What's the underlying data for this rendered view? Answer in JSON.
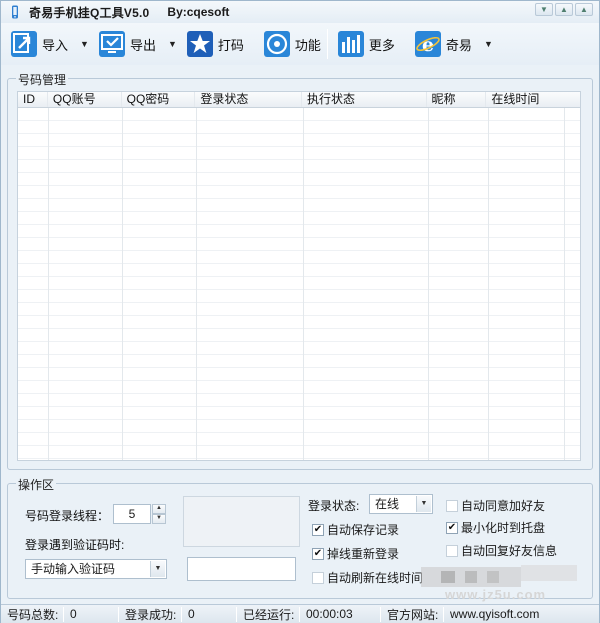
{
  "window": {
    "title": "奇易手机挂Q工具V5.0",
    "by": "By:cqesoft"
  },
  "toolbar": {
    "import": "导入",
    "export": "导出",
    "dama": "打码",
    "function": "功能",
    "more": "更多",
    "qiyi": "奇易"
  },
  "account_group": {
    "title": "号码管理",
    "columns": [
      "ID",
      "QQ账号",
      "QQ密码",
      "登录状态",
      "执行状态",
      "昵称",
      "在线时间"
    ],
    "rows": []
  },
  "ops": {
    "title": "操作区",
    "threads_label": "号码登录线程：",
    "threads_value": "5",
    "captcha_label": "登录遇到验证码时:",
    "captcha_mode": "手动输入验证码",
    "login_status_label": "登录状态:",
    "login_status_value": "在线",
    "auto_save": "自动保存记录",
    "reconnect": "掉线重新登录",
    "auto_refresh": "自动刷新在线时间",
    "auto_accept": "自动同意加好友",
    "minimize_tray": "最小化时到托盘",
    "auto_reply": "自动回复好友信息"
  },
  "status": {
    "total_label": "号码总数:",
    "total_value": "0",
    "success_label": "登录成功:",
    "success_value": "0",
    "running_label": "已经运行:",
    "running_value": "00:00:03",
    "site_label": "官方网站:",
    "site_value": "www.qyisoft.com"
  },
  "watermark": "www.jz5u.com"
}
